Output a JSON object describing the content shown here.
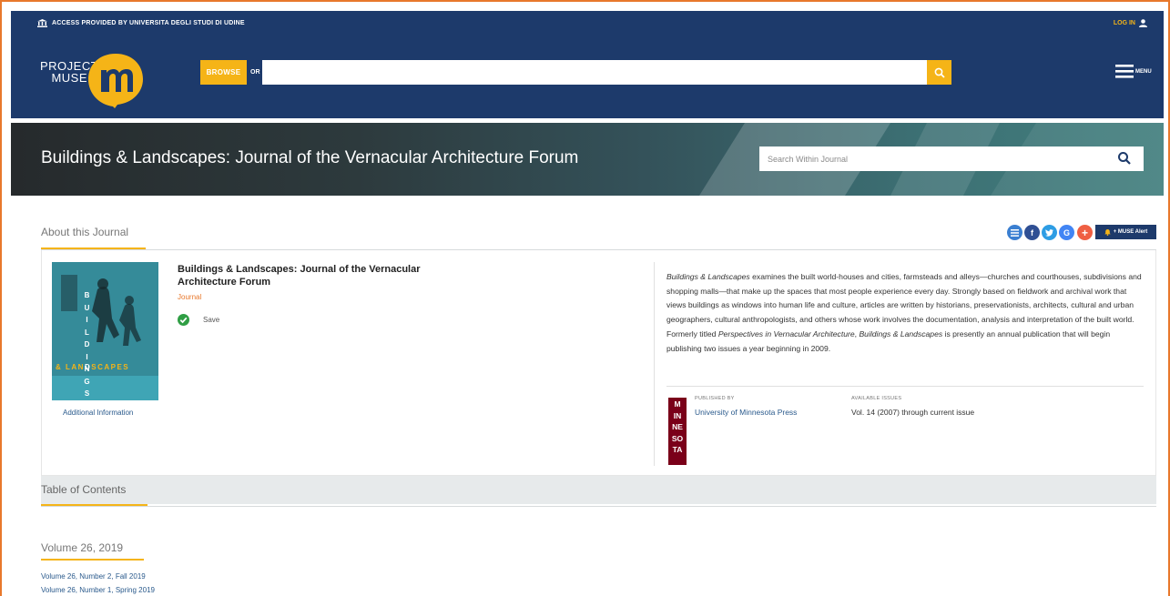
{
  "access_bar": {
    "text": "ACCESS PROVIDED BY UNIVERSITA DEGLI STUDI DI UDINE",
    "login_label": "LOG IN"
  },
  "header": {
    "logo_line1": "PROJECT",
    "logo_line2": "MUSE",
    "browse_label": "BROWSE",
    "or_label": "OR",
    "search_value": "",
    "menu_label": "MENU"
  },
  "banner": {
    "title": "Buildings & Landscapes: Journal of the Vernacular Architecture Forum",
    "search_placeholder": "Search Within Journal"
  },
  "about": {
    "section_label": "About this Journal",
    "alert_label": "+ MUSE Alert",
    "social_icons": [
      "list-icon",
      "facebook-icon",
      "twitter-icon",
      "google-icon",
      "plus-icon"
    ],
    "cover": {
      "letters_vertical": [
        "B",
        "U",
        "I",
        "L",
        "D",
        "I",
        "N",
        "G",
        "S"
      ],
      "letters_landscapes": "& LANDSCAPES"
    },
    "additional_info": "Additional Information",
    "journal_title": "Buildings & Landscapes: Journal of the Vernacular Architecture Forum",
    "journal_type": "Journal",
    "save_label": "Save",
    "description_parts": [
      {
        "text": "Buildings & Landscapes",
        "italic": true
      },
      {
        "text": " examines the built world-houses and cities, farmsteads and alleys—churches and courthouses, subdivisions and shopping malls—that make up the spaces that most people experience every day. Strongly based on fieldwork and archival work that views buildings as windows into human life and culture, articles are written by historians, preservationists, architects, cultural and urban geographers, cultural anthropologists, and others whose work involves the documentation, analysis and interpretation of the built world. Formerly titled ",
        "italic": false
      },
      {
        "text": "Perspectives in Vernacular Architecture",
        "italic": true
      },
      {
        "text": ", ",
        "italic": false
      },
      {
        "text": "Buildings & Landscapes",
        "italic": true
      },
      {
        "text": " is presently an annual publication that will begin publishing two issues a year beginning in 2009.",
        "italic": false
      }
    ],
    "publisher_logo_lines": [
      "M",
      "IN",
      "NE",
      "SO",
      "TA"
    ],
    "published_by_label": "PUBLISHED BY",
    "publisher": "University of Minnesota Press",
    "available_issues_label": "AVAILABLE ISSUES",
    "available_issues": "Vol. 14 (2007) through current issue"
  },
  "toc": {
    "section_label": "Table of Contents",
    "volume_heading": "Volume 26, 2019",
    "issues": [
      "Volume 26, Number 2, Fall 2019",
      "Volume 26, Number 1, Spring 2019"
    ]
  },
  "colors": {
    "navy": "#1d3a6b",
    "gold": "#f5b417",
    "orange": "#e8782c",
    "link": "#2a5a8c",
    "maroon": "#7a0019"
  }
}
